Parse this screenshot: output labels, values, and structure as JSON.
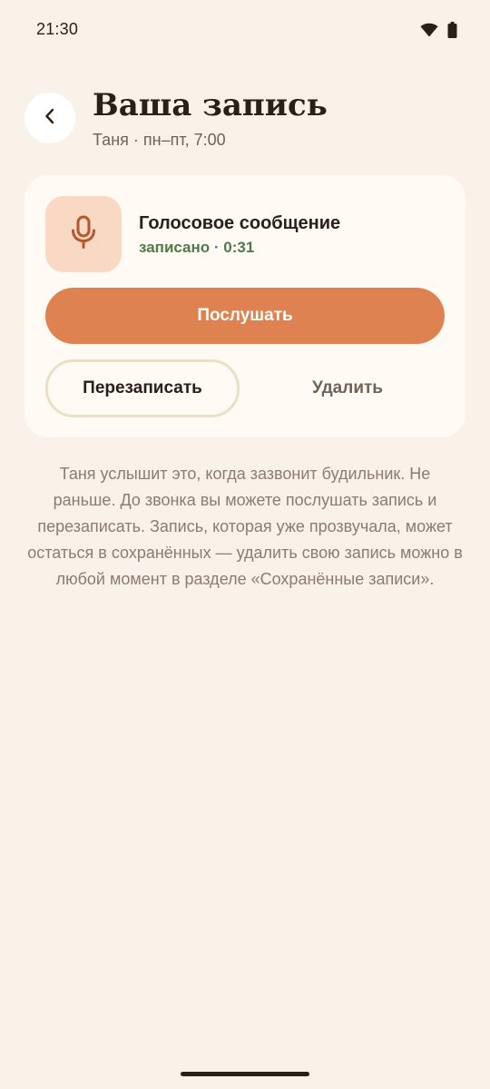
{
  "status_bar": {
    "time": "21:30",
    "icons": [
      "wifi-icon",
      "battery-icon"
    ]
  },
  "header": {
    "back_icon": "chevron-left-icon",
    "title": "Ваша запись",
    "subtitle": "Таня · пн–пт, 7:00"
  },
  "card": {
    "icon": "microphone-icon",
    "title": "Голосовое сообщение",
    "status": "записано · 0:31",
    "listen_label": "Послушать",
    "rerecord_label": "Перезаписать",
    "delete_label": "Удалить"
  },
  "info_text": "Таня услышит это, когда зазвонит будильник. Не раньше. До звонка вы можете послушать запись и перезаписать. Запись, которая уже прозвучала, может остаться в сохранённых — удалить свою запись можно в любой момент в разделе «Сохранённые записи».",
  "colors": {
    "background": "#faf1e8",
    "card": "#fffaf3",
    "accent": "#df8252",
    "mic_tile": "#f9d8c4",
    "mic_icon": "#b4592d",
    "status_green": "#4f7a4a",
    "outline": "#ecdfc8"
  }
}
